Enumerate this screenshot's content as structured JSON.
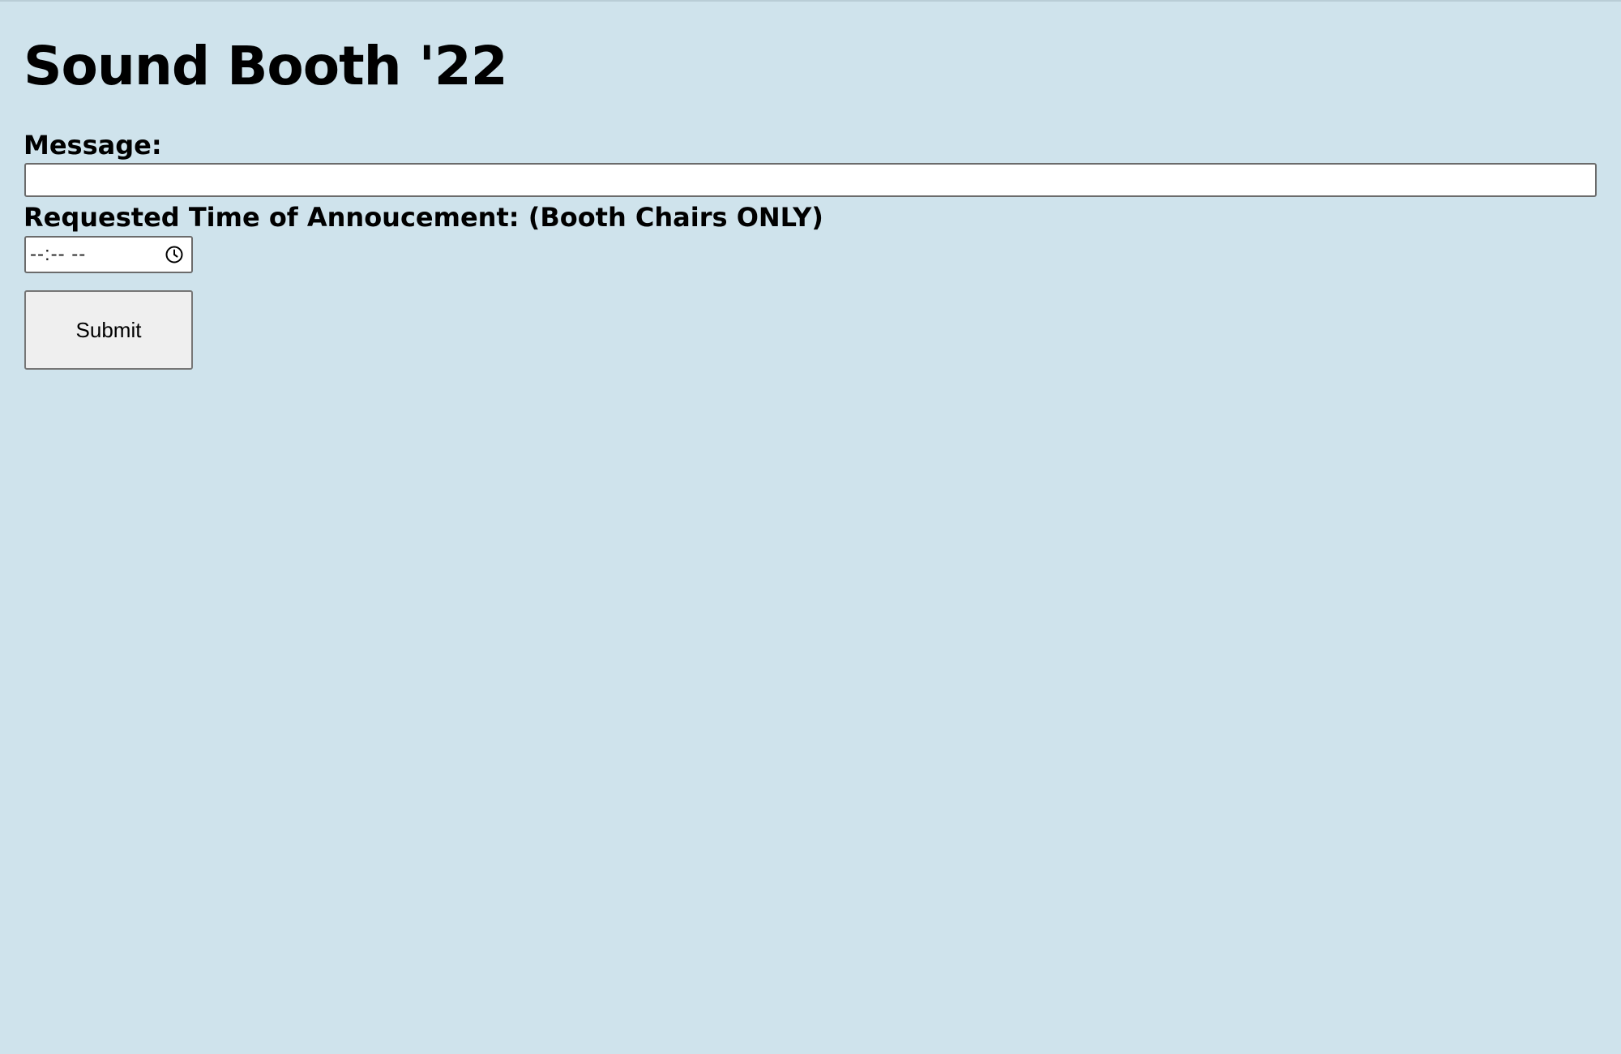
{
  "page": {
    "title": "Sound Booth '22"
  },
  "form": {
    "message_label": "Message:",
    "message_value": "",
    "time_label": "Requested Time of Annoucement: (Booth Chairs ONLY)",
    "time_value": "--:-- --",
    "time_icon": "clock-icon",
    "submit_label": "Submit"
  },
  "colors": {
    "background": "#cfe3ec",
    "input_background": "#ffffff",
    "button_background": "#efefef"
  }
}
